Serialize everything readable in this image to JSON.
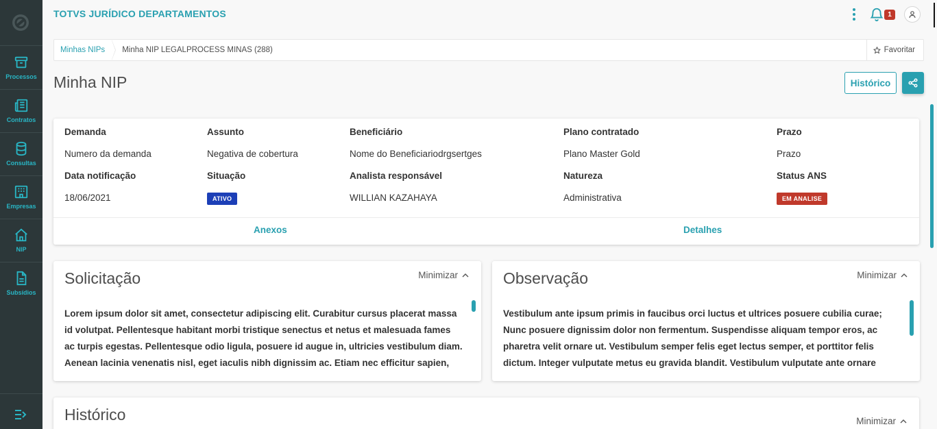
{
  "app": {
    "title": "TOTVS JURÍDICO DEPARTAMENTOS",
    "notification_count": "1"
  },
  "sidebar": {
    "items": [
      {
        "label": "Processos",
        "icon": "archive-icon"
      },
      {
        "label": "Contratos",
        "icon": "newspaper-icon"
      },
      {
        "label": "Consultas",
        "icon": "database-icon"
      },
      {
        "label": "Empresas",
        "icon": "building-icon"
      },
      {
        "label": "NIP",
        "icon": "home-icon"
      },
      {
        "label": "Subsídios",
        "icon": "document-icon"
      }
    ]
  },
  "breadcrumb": {
    "parent": "Minhas NIPs",
    "current": "Minha NIP LEGALPROCESS MINAS (288)",
    "favorite": "Favoritar"
  },
  "page": {
    "title": "Minha NIP",
    "history_button": "Histórico"
  },
  "info": {
    "demanda_label": "Demanda",
    "demanda_value": "Numero da demanda",
    "assunto_label": "Assunto",
    "assunto_value": "Negativa de cobertura",
    "beneficiario_label": "Beneficiário",
    "beneficiario_value": "Nome do Beneficiariodrgsertges",
    "plano_label": "Plano contratado",
    "plano_value": "Plano Master Gold",
    "prazo_label": "Prazo",
    "prazo_value": "Prazo",
    "data_label": "Data notificação",
    "data_value": "18/06/2021",
    "situacao_label": "Situação",
    "situacao_value": "ATIVO",
    "analista_label": "Analista responsável",
    "analista_value": "WILLIAN KAZAHAYA",
    "natureza_label": "Natureza",
    "natureza_value": "Administrativa",
    "status_label": "Status ANS",
    "status_value": "EM ANALISE",
    "anexos_link": "Anexos",
    "detalhes_link": "Detalhes"
  },
  "solicitacao": {
    "title": "Solicitação",
    "minimize": "Minimizar",
    "body": "Lorem ipsum dolor sit amet, consectetur adipiscing elit. Curabitur cursus placerat massa id volutpat. Pellentesque habitant morbi tristique senectus et netus et malesuada fames ac turpis egestas. Pellentesque odio ligula, posuere id augue in, ultricies vestibulum diam. Aenean lacinia venenatis nisl, eget iaculis nibh dignissim ac. Etiam nec efficitur sapien,"
  },
  "observacao": {
    "title": "Observação",
    "minimize": "Minimizar",
    "body": "Vestibulum ante ipsum primis in faucibus orci luctus et ultrices posuere cubilia curae; Nunc posuere dignissim dolor non fermentum. Suspendisse aliquam tempor eros, ac pharetra velit ornare ut. Vestibulum semper felis eget lectus semper, et porttitor felis dictum. Integer vulputate metus eu gravida blandit. Vestibulum vulputate ante ornare magna"
  },
  "historico": {
    "title": "Histórico",
    "minimize": "Minimizar"
  },
  "colors": {
    "accent": "#29a0b0",
    "sidebar": "#2c3739",
    "tag_active": "#1c3fb7",
    "tag_status": "#c0392b"
  }
}
